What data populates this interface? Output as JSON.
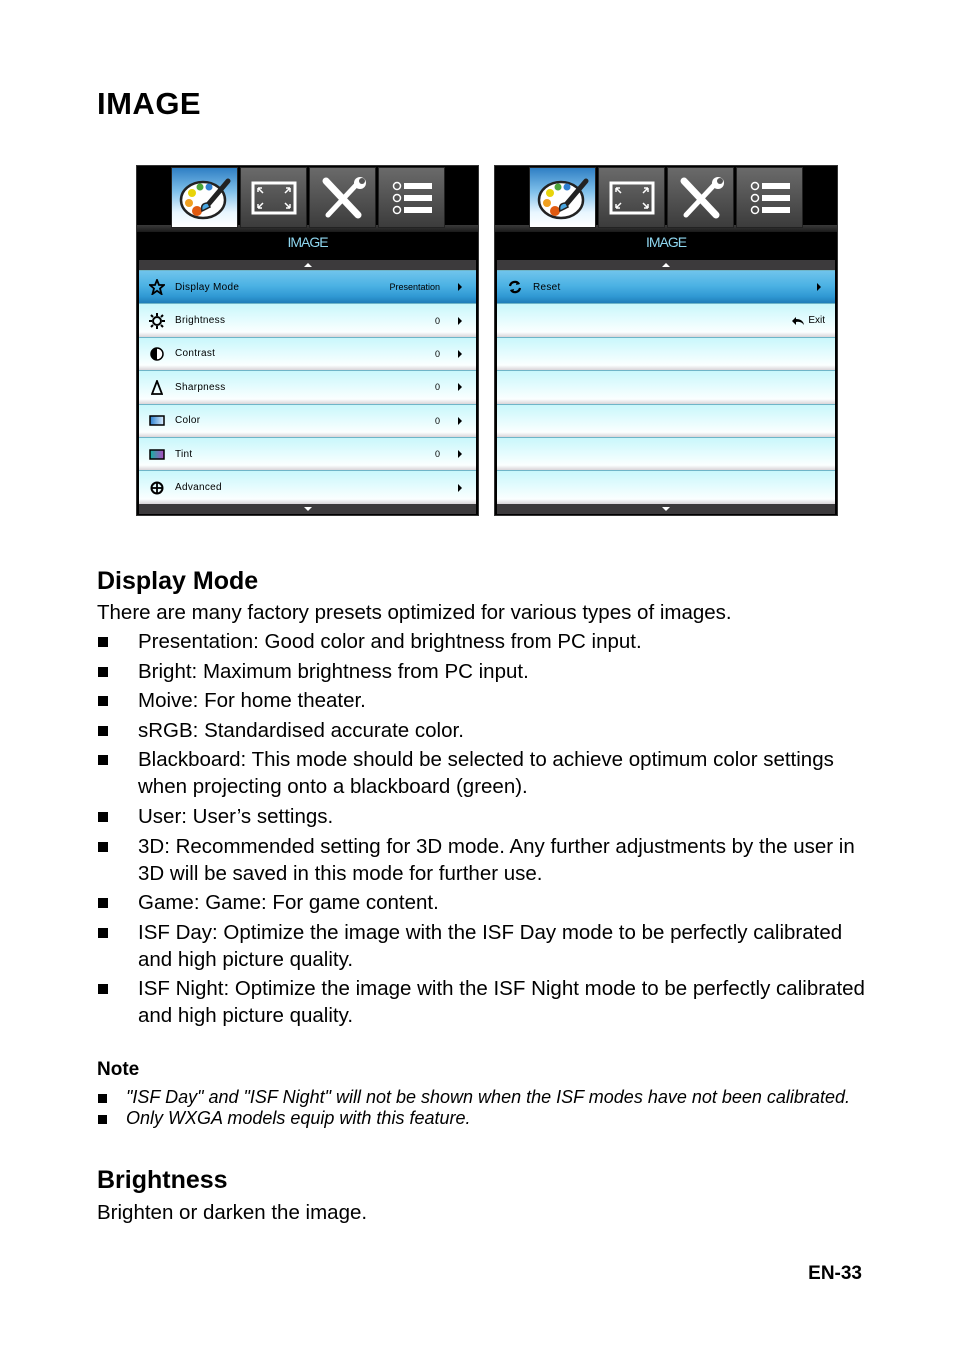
{
  "page": {
    "title": "IMAGE",
    "page_number": "EN-33"
  },
  "osd_left": {
    "tabs": [
      {
        "icon": "palette-icon",
        "active": true
      },
      {
        "icon": "screen-resize-icon",
        "active": false
      },
      {
        "icon": "tools-icon",
        "active": false
      },
      {
        "icon": "options-list-icon",
        "active": false
      }
    ],
    "menu_title": "IMAGE",
    "rows": [
      {
        "icon": "star-icon",
        "label": "Display Mode",
        "value": "Presentation",
        "selected": true
      },
      {
        "icon": "sun-icon",
        "label": "Brightness",
        "value": "0"
      },
      {
        "icon": "contrast-icon",
        "label": "Contrast",
        "value": "0"
      },
      {
        "icon": "sharpness-icon",
        "label": "Sharpness",
        "value": "0"
      },
      {
        "icon": "color-icon",
        "label": "Color",
        "value": "0"
      },
      {
        "icon": "tint-icon",
        "label": "Tint",
        "value": "0"
      },
      {
        "icon": "advanced-icon",
        "label": "Advanced",
        "value": ""
      }
    ]
  },
  "osd_right": {
    "menu_title": "IMAGE",
    "rows": [
      {
        "icon": "reset-icon",
        "label": "Reset",
        "selected": true
      },
      {
        "exit_label": "Exit"
      }
    ]
  },
  "display_mode": {
    "heading": "Display Mode",
    "intro": "There are many factory presets optimized for various types of images.",
    "items": [
      "Presentation: Good color and brightness from PC input.",
      "Bright: Maximum brightness from PC input.",
      "Moive: For home theater.",
      "sRGB: Standardised accurate color.",
      "Blackboard: This mode should be selected to achieve optimum color settings when projecting onto a blackboard (green).",
      "User: User’s settings.",
      "3D: Recommended setting for 3D mode. Any further adjustments by the user in 3D will be saved in this mode for further use.",
      "Game: Game: For game content.",
      "ISF Day: Optimize the image with the ISF Day mode to be perfectly calibrated and high picture quality.",
      "ISF Night: Optimize the image with the ISF Night mode to be perfectly calibrated and high picture quality."
    ]
  },
  "note": {
    "title": "Note",
    "items": [
      "\"ISF Day\" and \"ISF Night\" will not be shown when the ISF modes have not been calibrated.",
      "Only WXGA models equip with this feature."
    ]
  },
  "brightness": {
    "heading": "Brightness",
    "text": "Brighten or darken the image."
  }
}
